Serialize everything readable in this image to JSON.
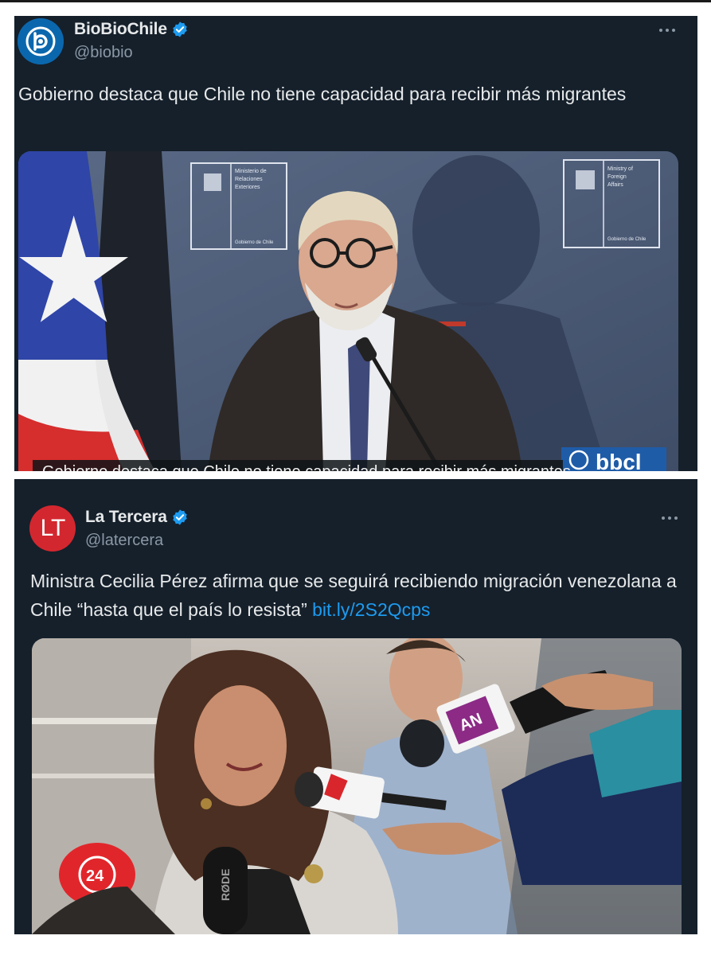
{
  "tweets": [
    {
      "display_name": "BioBioChile",
      "handle": "@biobio",
      "verified": true,
      "avatar_icon": "biobio-logo-icon",
      "text": "Gobierno destaca que Chile no tiene capacidad para recibir más migrantes",
      "media": {
        "caption": "Gobierno destaca que Chile no tiene capacidad para recibir más migrantes",
        "watermark": "bbcl",
        "sign_left": [
          "Ministerio de",
          "Relaciones",
          "Exteriores",
          "Gobierno de Chile"
        ],
        "sign_right": [
          "Ministry of",
          "Foreign",
          "Affairs",
          "Gobierno de Chile"
        ]
      }
    },
    {
      "display_name": "La Tercera",
      "handle": "@latercera",
      "verified": true,
      "avatar_text": "LT",
      "text": "Ministra Cecilia Pérez afirma que se seguirá recibiendo migración venezolana a Chile “hasta que el país lo resista”",
      "link": "bit.ly/2S2Qcps",
      "media": {
        "mic_labels": [
          "AN",
          "24",
          "RØDE"
        ]
      }
    }
  ],
  "colors": {
    "card_bg": "#15202b",
    "text": "#e7e9ea",
    "muted": "#8b98a5",
    "link": "#1d9bf0",
    "verified": "#1d9bf0"
  }
}
